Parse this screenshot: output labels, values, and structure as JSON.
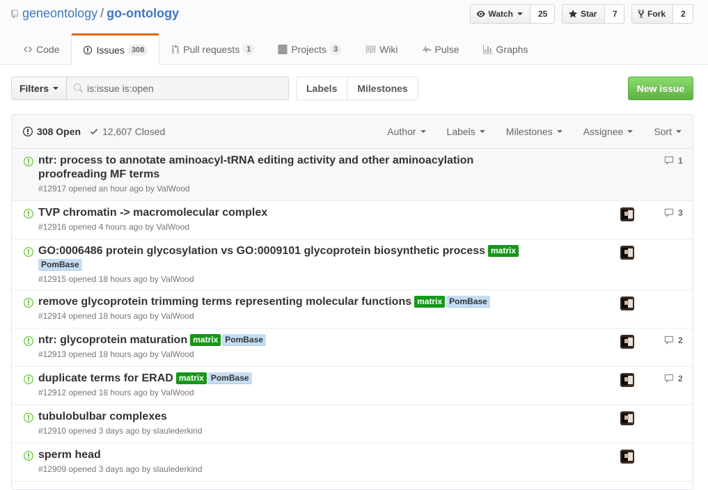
{
  "repo": {
    "owner": "geneontology",
    "separator": "/",
    "name": "go-ontology"
  },
  "actions": {
    "watch_label": "Watch",
    "watch_count": "25",
    "star_label": "Star",
    "star_count": "7",
    "fork_label": "Fork",
    "fork_count": "2"
  },
  "tabs": [
    {
      "label": "Code",
      "icon": "code-icon",
      "count": null
    },
    {
      "label": "Issues",
      "icon": "issue-opened-icon",
      "count": "308"
    },
    {
      "label": "Pull requests",
      "icon": "git-pull-request-icon",
      "count": "1"
    },
    {
      "label": "Projects",
      "icon": "project-icon",
      "count": "3"
    },
    {
      "label": "Wiki",
      "icon": "book-icon",
      "count": null
    },
    {
      "label": "Pulse",
      "icon": "pulse-icon",
      "count": null
    },
    {
      "label": "Graphs",
      "icon": "graph-icon",
      "count": null
    }
  ],
  "subnav": {
    "filters_label": "Filters",
    "search_value": "is:issue is:open",
    "labels_label": "Labels",
    "milestones_label": "Milestones",
    "new_issue_label": "New issue"
  },
  "list_header": {
    "open_label": "308 Open",
    "closed_label": "12,607 Closed",
    "menus": [
      "Author",
      "Labels",
      "Milestones",
      "Assignee",
      "Sort"
    ]
  },
  "colors": {
    "open_icon": "#6cc644",
    "tab_accent": "#e36209",
    "link": "#4078c0",
    "label_matrix": "#159818",
    "label_pombase": "#c5def5"
  },
  "issues": [
    {
      "title_line1": "ntr: process to annotate aminoacyl-tRNA editing activity and other aminoacylation",
      "title_line2": "proofreading MF terms",
      "meta": "#12917 opened an hour ago by ValWood",
      "comments": "1",
      "avatar": false
    },
    {
      "title": "TVP chromatin -> macromolecular complex",
      "meta": "#12916 opened 4 hours ago by ValWood",
      "comments": "3",
      "avatar": true
    },
    {
      "title": "GO:0006486 protein glycosylation vs GO:0009101 glycoprotein biosynthetic process",
      "labels": [
        "matrix",
        "PomBase"
      ],
      "meta": "#12915 opened 18 hours ago by ValWood",
      "avatar": true
    },
    {
      "title": "remove glycoprotein trimming terms representing molecular functions",
      "labels": [
        "matrix",
        "PomBase"
      ],
      "meta": "#12914 opened 18 hours ago by ValWood",
      "avatar": true
    },
    {
      "title": "ntr: glycoprotein maturation",
      "labels": [
        "matrix",
        "PomBase"
      ],
      "meta": "#12913 opened 18 hours ago by ValWood",
      "comments": "2",
      "avatar": true
    },
    {
      "title": "duplicate terms for ERAD",
      "labels": [
        "matrix",
        "PomBase"
      ],
      "meta": "#12912 opened 18 hours ago by ValWood",
      "comments": "2",
      "avatar": true
    },
    {
      "title": "tubulobulbar complexes",
      "meta": "#12910 opened 3 days ago by slaulederkind",
      "avatar": true
    },
    {
      "title": "sperm head",
      "meta": "#12909 opened 3 days ago by slaulederkind",
      "avatar": true
    }
  ]
}
